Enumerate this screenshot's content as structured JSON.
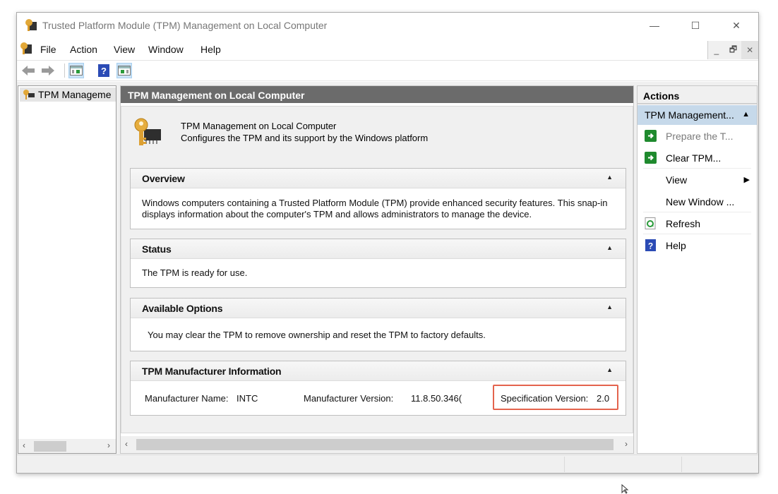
{
  "window": {
    "title": "Trusted Platform Module (TPM) Management on Local Computer",
    "controls": {
      "minimize": "—",
      "maximize": "☐",
      "close": "✕"
    }
  },
  "menubar": {
    "items": [
      "File",
      "Action",
      "View",
      "Window",
      "Help"
    ],
    "mdi_controls": {
      "minimize": "_",
      "restore": "🗗",
      "close": "✕"
    }
  },
  "toolbar": {
    "buttons": [
      "back-icon",
      "forward-icon",
      "show-hide-console-tree-icon",
      "help-icon",
      "show-hide-action-pane-icon"
    ]
  },
  "tree": {
    "item_label": "TPM Manageme"
  },
  "center": {
    "header_title": "TPM Management on Local Computer",
    "intro": {
      "title": "TPM Management on Local Computer",
      "description": "Configures the TPM and its support by the Windows platform"
    },
    "sections": {
      "overview": {
        "title": "Overview",
        "text": "Windows computers containing a Trusted Platform Module (TPM) provide enhanced security features. This snap-in displays information about the computer's TPM and allows administrators to manage the device."
      },
      "status": {
        "title": "Status",
        "text": "The TPM is ready for use."
      },
      "options": {
        "title": "Available Options",
        "text": "You may clear the TPM to remove ownership and reset the TPM to factory defaults."
      },
      "manufacturer": {
        "title": "TPM Manufacturer Information",
        "name_label": "Manufacturer Name:",
        "name_value": "INTC",
        "version_label": "Manufacturer Version:",
        "version_value": "11.8.50.346(",
        "spec_label": "Specification Version:",
        "spec_value": "2.0"
      }
    },
    "collapse_glyph": "▲"
  },
  "actions": {
    "header": "Actions",
    "group_label": "TPM Management...",
    "items": [
      {
        "label": "Prepare the T...",
        "icon": "green-arrow-icon",
        "disabled": true
      },
      {
        "label": "Clear TPM...",
        "icon": "green-arrow-icon",
        "disabled": false
      },
      {
        "label": "View",
        "icon": "",
        "submenu": true
      },
      {
        "label": "New Window ...",
        "icon": ""
      },
      {
        "label": "Refresh",
        "icon": "refresh-icon"
      },
      {
        "label": "Help",
        "icon": "help-icon"
      }
    ]
  },
  "colors": {
    "header_bg": "#6b6b6b",
    "actions_group_bg": "#c6d9ea",
    "highlight_border": "#e4634d",
    "green_icon": "#1f8a2e",
    "help_blue": "#2b4bb5"
  }
}
